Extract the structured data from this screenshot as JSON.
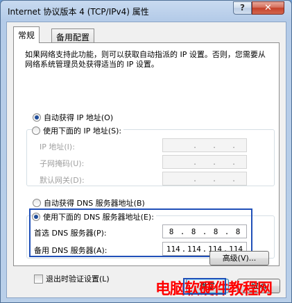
{
  "window": {
    "title": "Internet 协议版本 4 (TCP/IPv4) 属性",
    "help_label": "?",
    "close_label": "✕"
  },
  "tabs": [
    {
      "label": "常规",
      "active": true
    },
    {
      "label": "备用配置",
      "active": false
    }
  ],
  "description": "如果网络支持此功能，则可以获取自动指派的 IP 设置。否则，您需要从网络系统管理员处获得适当的 IP 设置。",
  "ip_section": {
    "auto_label": "自动获得 IP 地址(O)",
    "auto_selected": true,
    "manual_label": "使用下面的 IP 地址(S):",
    "manual_selected": false,
    "fields": [
      {
        "label": "IP 地址(I):",
        "octets": [
          "",
          "",
          "",
          ""
        ]
      },
      {
        "label": "子网掩码(U):",
        "octets": [
          "",
          "",
          "",
          ""
        ]
      },
      {
        "label": "默认网关(D):",
        "octets": [
          "",
          "",
          "",
          ""
        ]
      }
    ]
  },
  "dns_section": {
    "auto_label": "自动获得 DNS 服务器地址(B)",
    "auto_selected": false,
    "manual_label": "使用下面的 DNS 服务器地址(E):",
    "manual_selected": true,
    "fields": [
      {
        "label": "首选 DNS 服务器(P):",
        "octets": [
          "8",
          "8",
          "8",
          "8"
        ]
      },
      {
        "label": "备用 DNS 服务器(A):",
        "octets": [
          "114",
          "114",
          "114",
          "114"
        ]
      }
    ]
  },
  "validate_label": "退出时验证设置(L)",
  "validate_checked": false,
  "advanced_label": "高级(V)...",
  "ok_label": "确定",
  "cancel_label": "取消",
  "watermark": "电脑软硬件教程网",
  "colors": {
    "highlight": "#1f4fb8",
    "watermark": "#ff0000"
  }
}
